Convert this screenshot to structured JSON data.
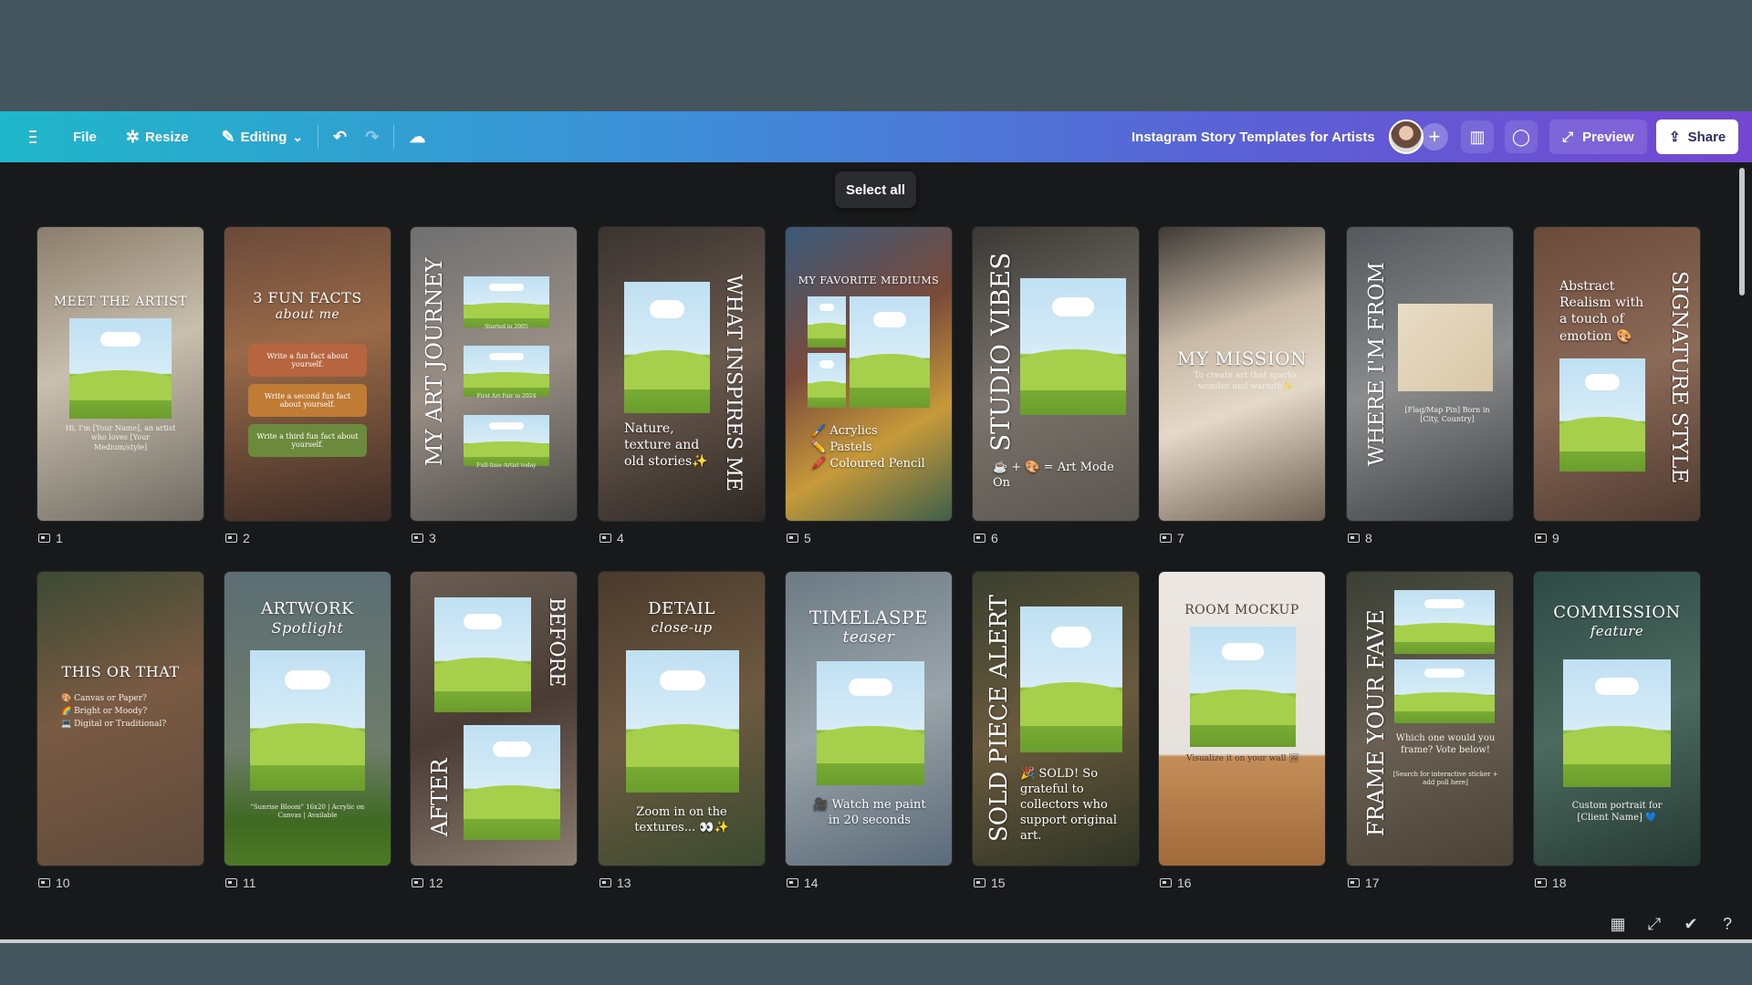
{
  "toolbar": {
    "file_label": "File",
    "resize_label": "Resize",
    "editing_label": "Editing",
    "doc_title": "Instagram Story Templates for Artists",
    "preview_label": "Preview",
    "share_label": "Share"
  },
  "canvas": {
    "select_all_label": "Select all"
  },
  "pages": [
    {
      "num": "1",
      "title": "MEET THE ARTIST",
      "body": "Hi, I'm [Your Name], an artist who loves [Your Medium/style]"
    },
    {
      "num": "2",
      "title": "3 FUN FACTS",
      "subtitle": "about me",
      "facts": [
        "Write a fun fact about yourself.",
        "Write a second fun fact about yourself.",
        "Write a third fun fact about yourself."
      ]
    },
    {
      "num": "3",
      "title": "MY ART JOURNEY",
      "captions": [
        "Started in 2005",
        "First Art Fair in 2024",
        "Full-time Artist today"
      ]
    },
    {
      "num": "4",
      "title": "WHAT INSPIRES ME",
      "body": "Nature, texture and old stories✨"
    },
    {
      "num": "5",
      "title": "MY FAVORITE MEDIUMS",
      "items": [
        "🖌️ Acrylics",
        "✏️ Pastels",
        "🖍️ Coloured Pencil"
      ]
    },
    {
      "num": "6",
      "title": "STUDIO VIBES",
      "body": "☕ + 🎨 = Art Mode On"
    },
    {
      "num": "7",
      "title": "MY MISSION",
      "body": "To create art that sparks wonder and warmth✨"
    },
    {
      "num": "8",
      "title": "WHERE I'M FROM",
      "body": "[Flag/Map Pin] Born in [City, Country]"
    },
    {
      "num": "9",
      "title": "SIGNATURE STYLE",
      "body": "Abstract Realism with a touch of emotion 🎨"
    },
    {
      "num": "10",
      "title": "THIS OR THAT",
      "items": [
        "🎨 Canvas or Paper?",
        "🌈 Bright or Moody?",
        "💻 Digital or Traditional?"
      ]
    },
    {
      "num": "11",
      "title": "ARTWORK",
      "subtitle": "Spotlight",
      "body": "\"Sunrise Bloom\" 16x20 | Acrylic on Canvas | Available"
    },
    {
      "num": "12",
      "title_a": "BEFORE",
      "title_b": "AFTER"
    },
    {
      "num": "13",
      "title": "DETAIL",
      "subtitle": "close-up",
      "body": "Zoom in on the textures... 👀✨"
    },
    {
      "num": "14",
      "title": "TIMELASPE",
      "subtitle": "teaser",
      "body": "🎥 Watch me paint in 20 seconds"
    },
    {
      "num": "15",
      "title": "SOLD PIECE ALERT",
      "body": "🎉 SOLD! So grateful to collectors who support original art."
    },
    {
      "num": "16",
      "title": "ROOM MOCKUP",
      "body": "Visualize it on your wall 🖼"
    },
    {
      "num": "17",
      "title": "FRAME YOUR FAVE",
      "body": "Which one would you frame? Vote below!",
      "note": "[Search for interactive sticker + add poll here]"
    },
    {
      "num": "18",
      "title": "COMMISSION",
      "subtitle": "feature",
      "body": "Custom portrait for [Client Name] 💙"
    }
  ],
  "colors": {
    "accent_start": "#1fb7c9",
    "accent_end": "#7446d2",
    "canvas_bg": "#18191b"
  }
}
